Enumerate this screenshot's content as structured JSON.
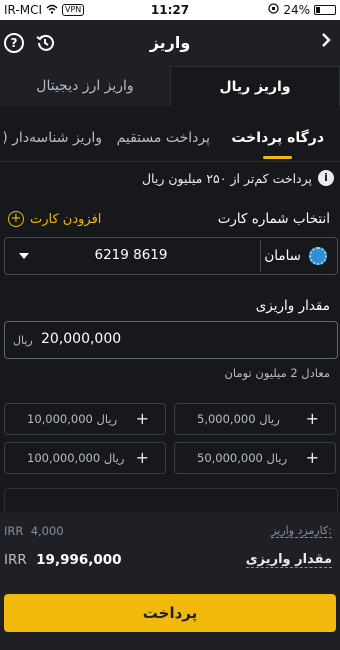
{
  "status": {
    "carrier": "IR-MCI",
    "vpn": "VPN",
    "time": "11:27",
    "battery": "24%"
  },
  "header": {
    "title": "واریز"
  },
  "top_tabs": {
    "rial": "واریز ریال",
    "crypto": "واریز ارز دیجیتال"
  },
  "sub_tabs": {
    "gateway": "درگاه پرداخت",
    "direct": "پرداخت مستقیم",
    "id_deposit": "واریز شناسه‌دار (پا"
  },
  "info": {
    "text": "پرداخت کم‌تر از ۲۵۰ میلیون ریال"
  },
  "card": {
    "label": "انتخاب شماره کارت",
    "add_label": "افزودن کارت",
    "bank": "سامان",
    "number": "6219 8619"
  },
  "amount": {
    "label": "مقدار واریزی",
    "unit": "ریال",
    "value": "20,000,000",
    "equivalent": "معادل 2 میلیون تومان"
  },
  "presets": [
    {
      "amount": "5,000,000",
      "unit": "ریال"
    },
    {
      "amount": "10,000,000",
      "unit": "ریال"
    },
    {
      "amount": "50,000,000",
      "unit": "ریال"
    },
    {
      "amount": "100,000,000",
      "unit": "ریال"
    }
  ],
  "summary": {
    "fee_label": "کارمزد واریز:",
    "fee_currency": "IRR",
    "fee_value": "4,000",
    "net_label": "مقدار واریزی",
    "net_currency": "IRR",
    "net_value": "19,996,000"
  },
  "pay_button": "پرداخت",
  "colors": {
    "accent": "#f0b90b",
    "background": "#16181c",
    "panel": "#1e2026"
  }
}
